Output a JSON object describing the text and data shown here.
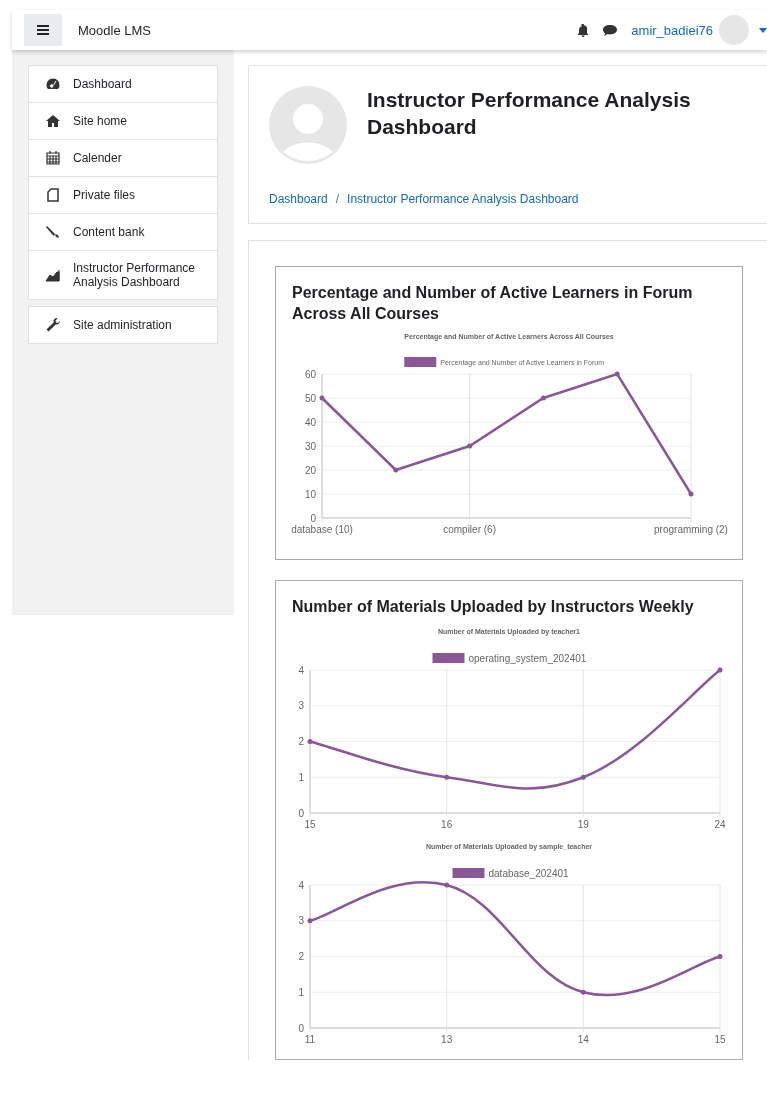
{
  "header": {
    "site_name": "Moodle LMS",
    "username": "amir_badiei76"
  },
  "sidebar": {
    "groups": [
      {
        "items": [
          {
            "label": "Dashboard"
          },
          {
            "label": "Site home"
          },
          {
            "label": "Calender"
          },
          {
            "label": "Private files"
          },
          {
            "label": "Content bank"
          },
          {
            "label": "Instructor Performance Analysis Dashboard"
          }
        ]
      },
      {
        "items": [
          {
            "label": "Site administration"
          }
        ]
      }
    ]
  },
  "page_header": {
    "title": "Instructor Performance Analysis Dashboard",
    "breadcrumb": {
      "separator": "/",
      "items": [
        "Dashboard",
        "Instructor Performance Analysis Dashboard"
      ]
    }
  },
  "cards": [
    {
      "title": "Percentage and Number of Active Learners in Forum Across All Courses",
      "charts": [
        {
          "kind": "straight",
          "chart_data": {
            "type": "line",
            "title": "Percentage and Number of Active Learners Across All Courses",
            "categories": [
              "database (10)",
              null,
              "compiler (6)",
              null,
              null,
              "programming (2)"
            ],
            "grid": true,
            "ylim": [
              0,
              60
            ],
            "yticks": [
              0,
              10,
              20,
              30,
              40,
              50,
              60
            ],
            "series": [
              {
                "name": "Percentage and Number of Active Learners in Forum",
                "color": "#8a5797",
                "values": [
                  50,
                  20,
                  30,
                  50,
                  60,
                  10
                ]
              }
            ]
          }
        }
      ]
    },
    {
      "title": "Number of Materials Uploaded by Instructors Weekly",
      "charts": [
        {
          "kind": "smooth",
          "chart_data": {
            "type": "line",
            "title": "Number of Materials Uploaded by teacher1",
            "categories": [
              "15",
              "16",
              "19",
              "24"
            ],
            "grid": true,
            "ylim": [
              0,
              4
            ],
            "yticks": [
              0,
              1,
              2,
              3,
              4
            ],
            "series": [
              {
                "name": "operating_system_202401",
                "color": "#8a5797",
                "values": [
                  2,
                  1,
                  1,
                  4
                ]
              }
            ]
          }
        },
        {
          "kind": "smooth",
          "chart_data": {
            "type": "line",
            "title": "Number of Materials Uploaded by sample_teacher",
            "categories": [
              "11",
              "13",
              "14",
              "15"
            ],
            "grid": true,
            "ylim": [
              0,
              4
            ],
            "yticks": [
              0,
              1,
              2,
              3,
              4
            ],
            "series": [
              {
                "name": "database_202401",
                "color": "#8a5797",
                "values": [
                  3,
                  4,
                  1,
                  2
                ]
              }
            ]
          }
        }
      ]
    }
  ]
}
